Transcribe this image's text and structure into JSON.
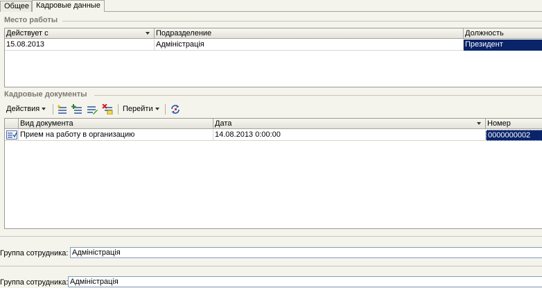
{
  "tabs": [
    {
      "label": "Общее",
      "active": false
    },
    {
      "label": "Кадровые данные",
      "active": true
    }
  ],
  "workplace": {
    "title": "Место работы",
    "columns": [
      "Действует с",
      "Подразделение",
      "Должность"
    ],
    "rows": [
      {
        "date": "15.08.2013",
        "department": "Адміністрація",
        "position": "Президент"
      }
    ]
  },
  "hr_documents": {
    "title": "Кадровые документы",
    "toolbar": {
      "actions_label": "Действия",
      "goto_label": "Перейти",
      "icons": [
        "add-icon",
        "add-copy-icon",
        "edit-icon",
        "delete-mark-icon",
        "refresh-icon"
      ]
    },
    "columns": [
      "Вид документа",
      "Дата",
      "Номер"
    ],
    "rows": [
      {
        "doc_type": "Прием на работу в организацию",
        "date": "14.08.2013 0:00:00",
        "number": "0000000002"
      }
    ]
  },
  "employee_group_1": {
    "label": "Группа сотрудника:",
    "value": "Адміністрація"
  },
  "employee_group_2": {
    "label": "Группа сотрудника:",
    "value": "Адміністрація"
  },
  "colors": {
    "selection": "#0a246a",
    "background": "#f5f4ec",
    "section_title": "#7a7a72"
  }
}
